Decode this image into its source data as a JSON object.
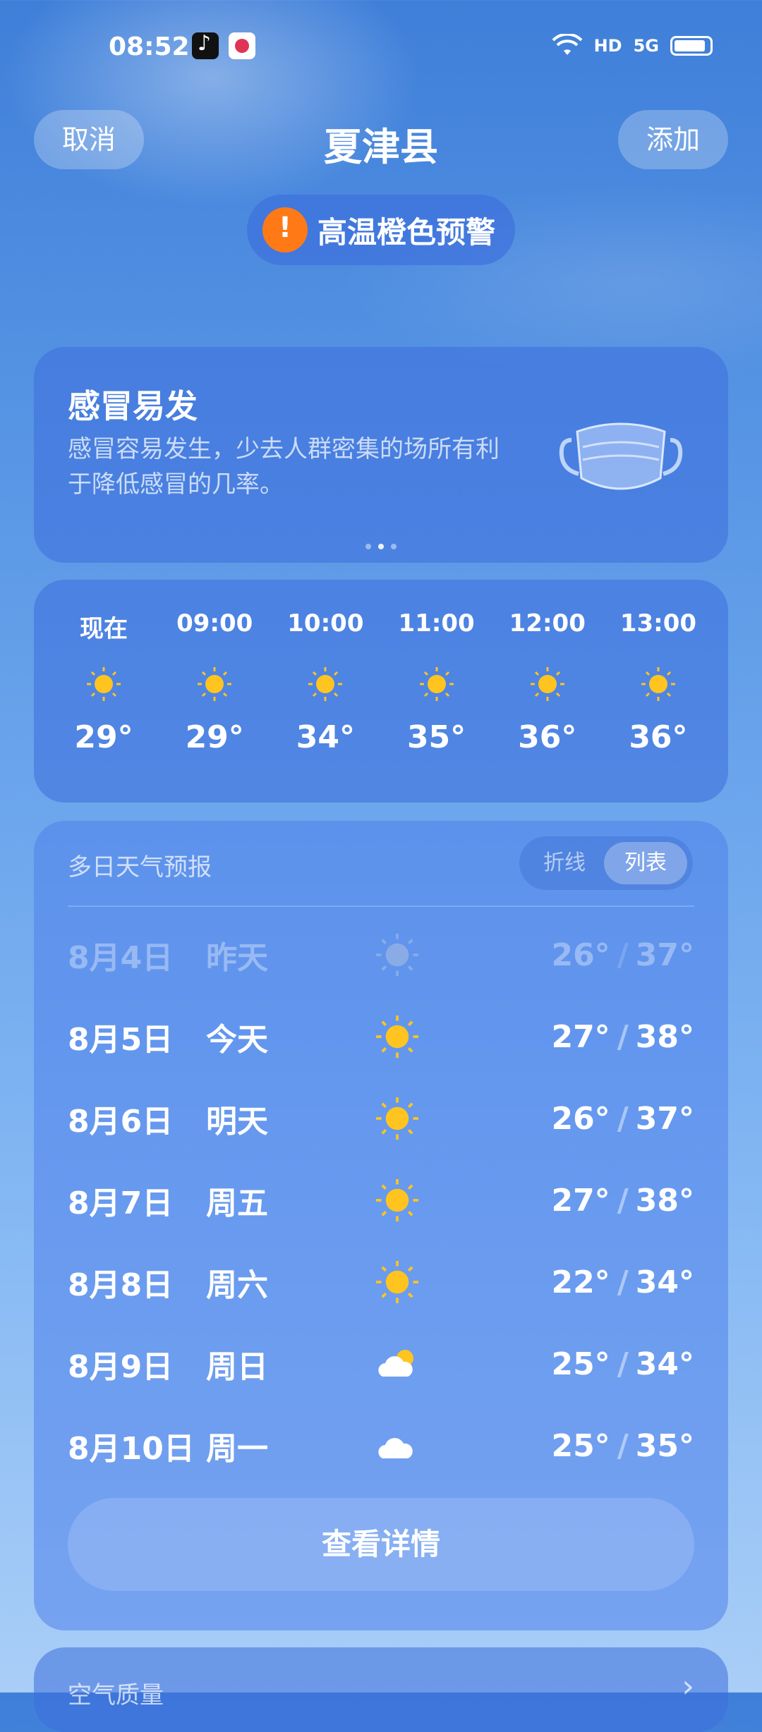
{
  "status_bar": {
    "time": "08:52",
    "network": "5G",
    "hd": "HD"
  },
  "header": {
    "cancel_label": "取消",
    "city": "夏津县",
    "add_label": "添加"
  },
  "alert": {
    "text": "高温橙色预警",
    "color": "#ff7a16"
  },
  "tip_card": {
    "title": "感冒易发",
    "description": "感冒容易发生，少去人群密集的场所有利于降低感冒的几率。",
    "icon": "mask-icon",
    "page_indicator_active": 1,
    "page_indicator_count": 3
  },
  "hourly": [
    {
      "time": "现在",
      "icon": "sun-icon",
      "temp": "29°"
    },
    {
      "time": "09:00",
      "icon": "sun-icon",
      "temp": "29°"
    },
    {
      "time": "10:00",
      "icon": "sun-icon",
      "temp": "34°"
    },
    {
      "time": "11:00",
      "icon": "sun-icon",
      "temp": "35°"
    },
    {
      "time": "12:00",
      "icon": "sun-icon",
      "temp": "36°"
    },
    {
      "time": "13:00",
      "icon": "sun-icon",
      "temp": "36°"
    }
  ],
  "forecast": {
    "title": "多日天气预报",
    "toggle_line": "折线",
    "toggle_list": "列表",
    "selected_toggle": "列表",
    "days": [
      {
        "date": "8月4日",
        "day": "昨天",
        "icon": "sun-icon",
        "low": "26°",
        "high": "37°",
        "past": true
      },
      {
        "date": "8月5日",
        "day": "今天",
        "icon": "sun-icon",
        "low": "27°",
        "high": "38°",
        "past": false
      },
      {
        "date": "8月6日",
        "day": "明天",
        "icon": "sun-icon",
        "low": "26°",
        "high": "37°",
        "past": false
      },
      {
        "date": "8月7日",
        "day": "周五",
        "icon": "sun-icon",
        "low": "27°",
        "high": "38°",
        "past": false
      },
      {
        "date": "8月8日",
        "day": "周六",
        "icon": "sun-icon",
        "low": "22°",
        "high": "34°",
        "past": false
      },
      {
        "date": "8月9日",
        "day": "周日",
        "icon": "partly-cloudy-icon",
        "low": "25°",
        "high": "34°",
        "past": false
      },
      {
        "date": "8月10日",
        "day": "周一",
        "icon": "cloud-icon",
        "low": "25°",
        "high": "35°",
        "past": false
      }
    ],
    "detail_button": "查看详情",
    "separator": "/"
  },
  "air_quality": {
    "title": "空气质量"
  },
  "colors": {
    "sun": "#ffc41f",
    "cloud": "#ffffff"
  }
}
